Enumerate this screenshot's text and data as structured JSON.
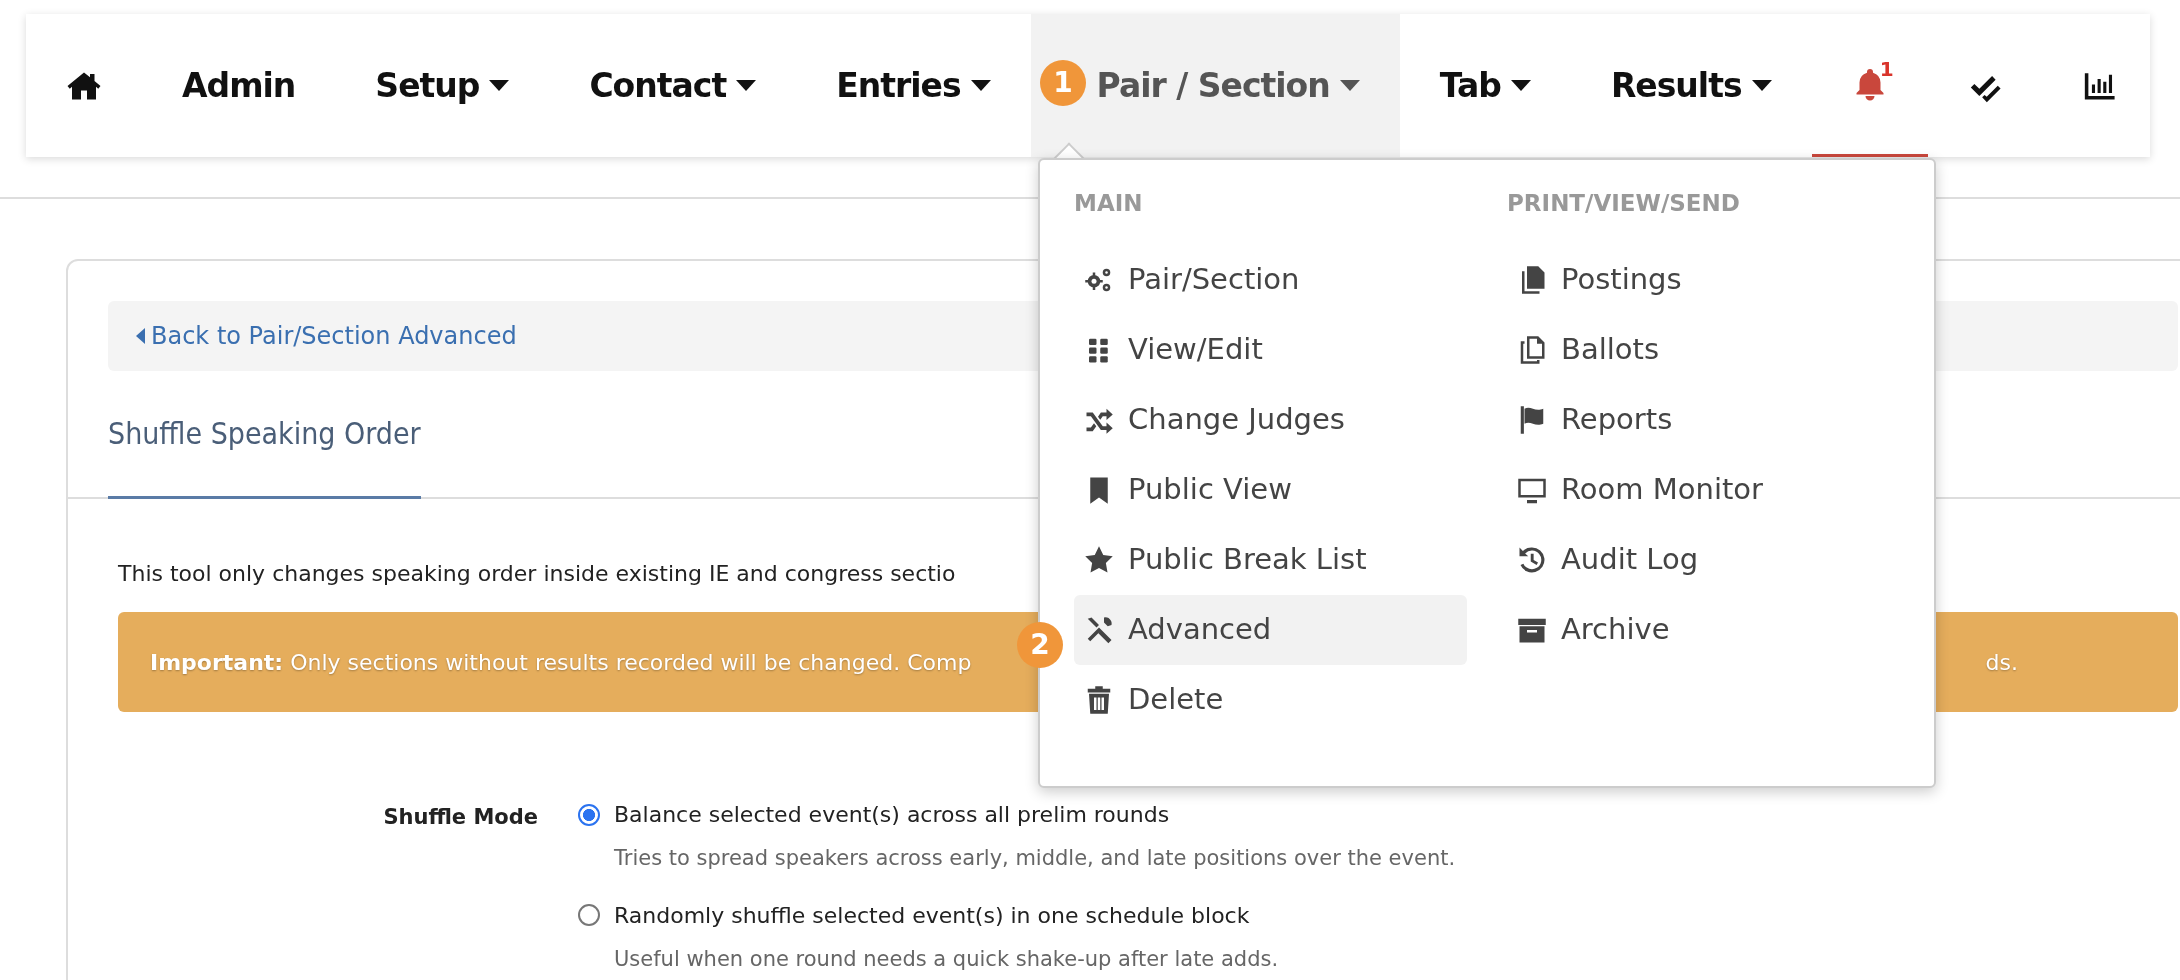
{
  "nav": {
    "items": [
      {
        "kind": "icon"
      },
      {
        "kind": "link",
        "label": "Admin",
        "dropdown": false,
        "selected": false
      },
      {
        "kind": "link",
        "label": "Setup",
        "dropdown": true,
        "selected": false
      },
      {
        "kind": "link",
        "label": "Contact",
        "dropdown": true,
        "selected": false
      },
      {
        "kind": "link",
        "label": "Entries",
        "dropdown": true,
        "selected": false
      },
      {
        "kind": "link",
        "label": "Pair / Section",
        "dropdown": true,
        "selected": true
      },
      {
        "kind": "link",
        "label": "Tab",
        "dropdown": true,
        "selected": false
      },
      {
        "kind": "link",
        "label": "Results",
        "dropdown": true,
        "selected": false
      },
      {
        "kind": "icon",
        "badge": "1",
        "alert": true
      },
      {
        "kind": "icon"
      },
      {
        "kind": "icon"
      }
    ]
  },
  "dropdown": {
    "columns": [
      {
        "heading": "MAIN",
        "items": [
          {
            "label": "Pair/Section",
            "selected": false
          },
          {
            "label": "View/Edit",
            "selected": false
          },
          {
            "label": "Change Judges",
            "selected": false
          },
          {
            "label": "Public View",
            "selected": false
          },
          {
            "label": "Public Break List",
            "selected": false
          },
          {
            "label": "Advanced",
            "selected": true
          },
          {
            "label": "Delete",
            "selected": false
          }
        ]
      },
      {
        "heading": "PRINT/VIEW/SEND",
        "items": [
          {
            "label": "Postings",
            "selected": false
          },
          {
            "label": "Ballots",
            "selected": false
          },
          {
            "label": "Reports",
            "selected": false
          },
          {
            "label": "Room Monitor",
            "selected": false
          },
          {
            "label": "Audit Log",
            "selected": false
          },
          {
            "label": "Archive",
            "selected": false
          }
        ]
      }
    ]
  },
  "callouts": [
    {
      "number": "1"
    },
    {
      "number": "2"
    }
  ],
  "back_link": "Back to Pair/Section Advanced",
  "title": "Shuffle Speaking Order",
  "intro": "This tool only changes speaking order inside existing IE and congress sectio",
  "alert": {
    "text_start": "**Important:** Only sections without results recorded will be changed. Comp",
    "text_end": "ds."
  },
  "shuffle_mode": {
    "label": "Shuffle Mode",
    "options": [
      {
        "label": "Balance selected event(s) across all prelim rounds",
        "help": "Tries to spread speakers across early, middle, and late positions over the event.",
        "selected": true
      },
      {
        "label": "Randomly shuffle selected event(s) in one schedule block",
        "help": "Useful when one round needs a quick shake-up after late adds.",
        "selected": false
      }
    ]
  }
}
